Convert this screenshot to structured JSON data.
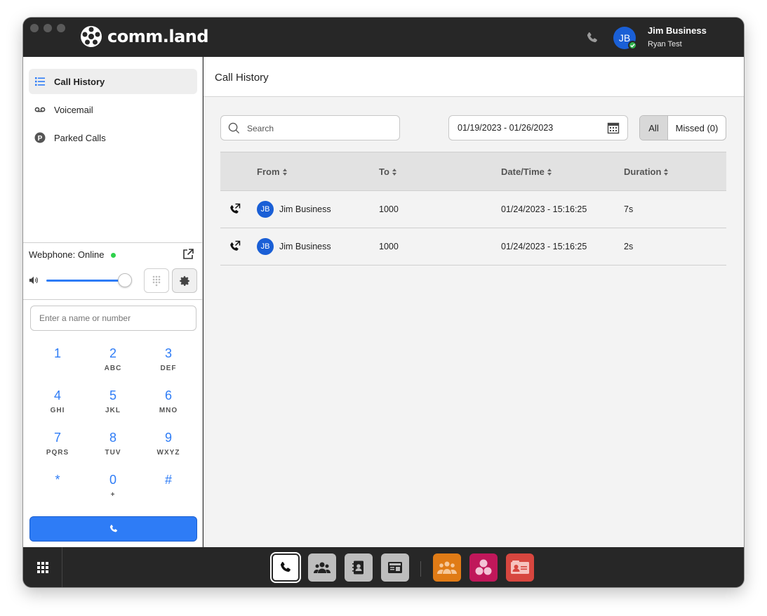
{
  "app": {
    "logo_text": "comm.land",
    "brand_color": "#2e7cf6"
  },
  "user": {
    "initials": "JB",
    "name": "Jim Business",
    "subtitle": "Ryan Test",
    "status": "online"
  },
  "sidebar": {
    "items": [
      {
        "label": "Call History",
        "icon": "list-icon",
        "active": true
      },
      {
        "label": "Voicemail",
        "icon": "voicemail-icon",
        "active": false
      },
      {
        "label": "Parked Calls",
        "icon": "parked-icon",
        "active": false
      }
    ]
  },
  "webphone": {
    "status_label": "Webphone: Online",
    "volume": 0.95,
    "dial_placeholder": "Enter a name or number",
    "keys": [
      {
        "digit": "1",
        "letters": ""
      },
      {
        "digit": "2",
        "letters": "ABC"
      },
      {
        "digit": "3",
        "letters": "DEF"
      },
      {
        "digit": "4",
        "letters": "GHI"
      },
      {
        "digit": "5",
        "letters": "JKL"
      },
      {
        "digit": "6",
        "letters": "MNO"
      },
      {
        "digit": "7",
        "letters": "PQRS"
      },
      {
        "digit": "8",
        "letters": "TUV"
      },
      {
        "digit": "9",
        "letters": "WXYZ"
      },
      {
        "digit": "*",
        "letters": ""
      },
      {
        "digit": "0",
        "letters": "+"
      },
      {
        "digit": "#",
        "letters": ""
      }
    ]
  },
  "main": {
    "title": "Call History",
    "search_placeholder": "Search",
    "date_range": "01/19/2023 - 01/26/2023",
    "filters": {
      "all": "All",
      "missed": "Missed (0)"
    },
    "columns": [
      "From",
      "To",
      "Date/Time",
      "Duration"
    ],
    "rows": [
      {
        "initials": "JB",
        "from": "Jim Business",
        "to": "1000",
        "datetime": "01/24/2023 - 15:16:25",
        "duration": "7s"
      },
      {
        "initials": "JB",
        "from": "Jim Business",
        "to": "1000",
        "datetime": "01/24/2023 - 15:16:25",
        "duration": "2s"
      }
    ]
  },
  "dock": {
    "items": [
      {
        "icon": "phone-icon",
        "active": true,
        "color": "#ffffff"
      },
      {
        "icon": "team-icon",
        "active": false,
        "color": "#bdbdbd"
      },
      {
        "icon": "contacts-icon",
        "active": false,
        "color": "#bdbdbd"
      },
      {
        "icon": "fax-icon",
        "active": false,
        "color": "#bdbdbd"
      },
      {
        "icon": "conference-icon",
        "active": false,
        "color": "#e07b16"
      },
      {
        "icon": "collab-icon",
        "active": false,
        "color": "#c0175a"
      },
      {
        "icon": "card-icon",
        "active": false,
        "color": "#d7463f"
      }
    ]
  }
}
